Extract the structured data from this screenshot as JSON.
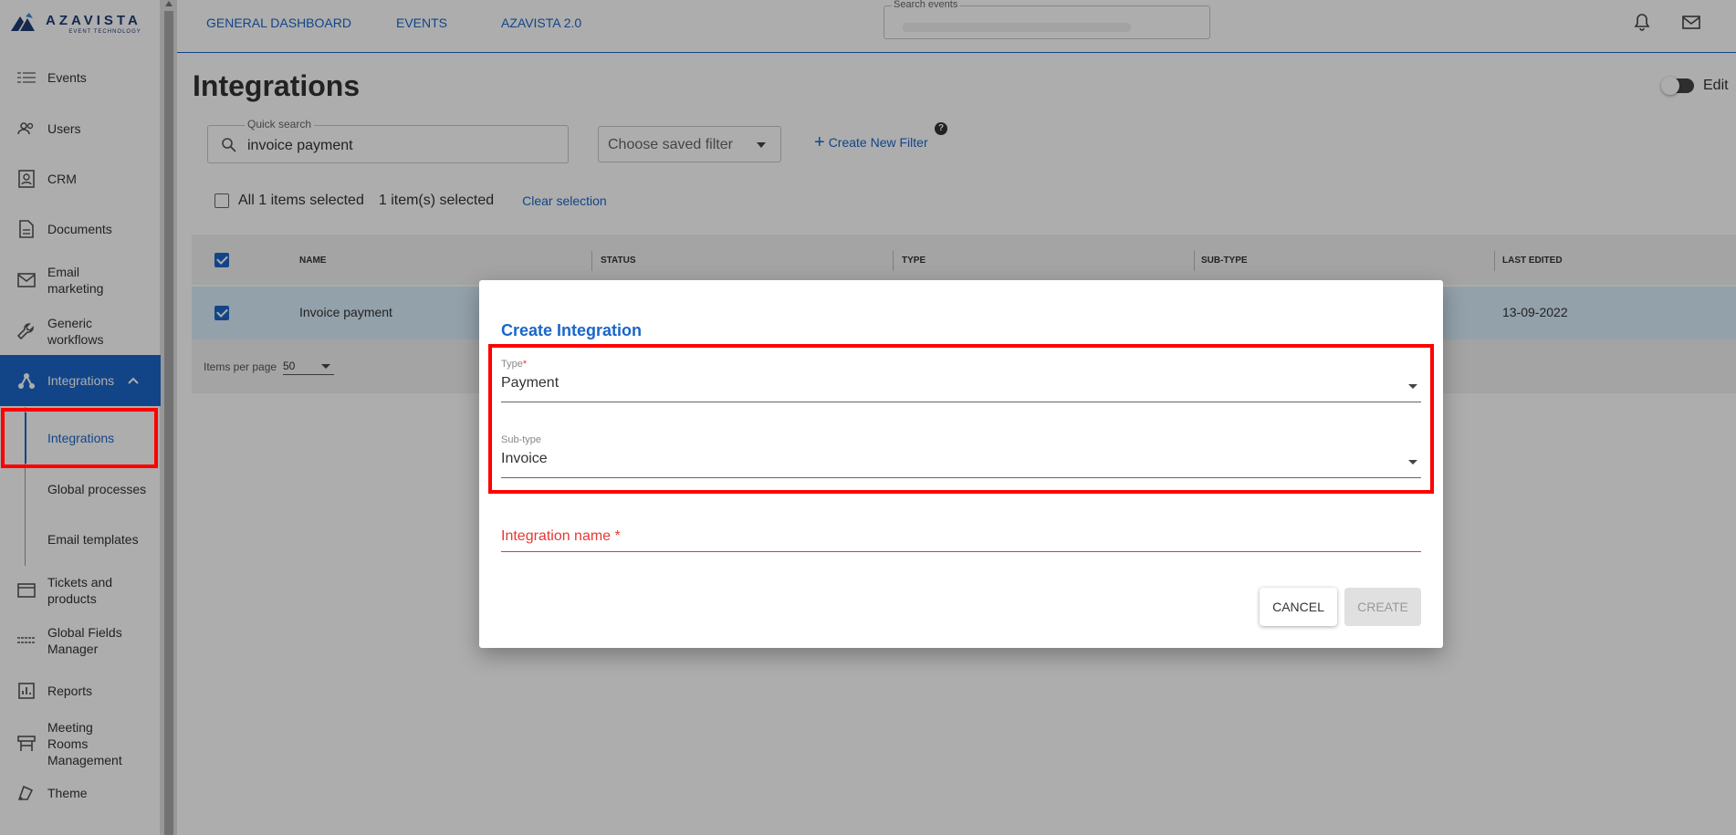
{
  "brand": {
    "name": "AZAVISTA",
    "tagline": "EVENT TECHNOLOGY",
    "color": "#1f3b73"
  },
  "sidebar": {
    "items": [
      {
        "label": "Events",
        "icon": "list-icon"
      },
      {
        "label": "Users",
        "icon": "users-icon"
      },
      {
        "label": "CRM",
        "icon": "contact-card-icon"
      },
      {
        "label": "Documents",
        "icon": "document-icon"
      },
      {
        "label": "Email\nmarketing",
        "icon": "mail-icon"
      },
      {
        "label": "Generic\nworkflows",
        "icon": "wrench-icon"
      },
      {
        "label": "Integrations",
        "icon": "integration-icon",
        "active": true
      },
      {
        "label": "Tickets and\nproducts",
        "icon": "ticket-icon"
      },
      {
        "label": "Global Fields\nManager",
        "icon": "fields-icon"
      },
      {
        "label": "Reports",
        "icon": "reports-icon"
      },
      {
        "label": "Meeting\nRooms\nManagement",
        "icon": "meeting-room-icon"
      },
      {
        "label": "Theme",
        "icon": "theme-icon"
      }
    ],
    "sub_items": [
      {
        "label": "Integrations",
        "current": true
      },
      {
        "label": "Global processes"
      },
      {
        "label": "Email templates"
      }
    ]
  },
  "topbar": {
    "links": [
      "GENERAL DASHBOARD",
      "EVENTS",
      "AZAVISTA 2.0"
    ],
    "search_label": "Search events"
  },
  "page": {
    "title": "Integrations",
    "edit_label": "Edit",
    "quick_search_label": "Quick search",
    "quick_search_value": "invoice payment",
    "saved_filter_placeholder": "Choose saved filter",
    "create_filter_label": "Create New Filter",
    "help_mark": "?",
    "selection": {
      "all_label": "All 1 items selected",
      "count_label": "1 item(s) selected",
      "clear_label": "Clear selection"
    },
    "table": {
      "columns": [
        "NAME",
        "STATUS",
        "TYPE",
        "SUB-TYPE",
        "LAST EDITED"
      ],
      "rows": [
        {
          "name": "Invoice payment",
          "status": "",
          "type": "",
          "subtype": "",
          "last_edited": "13-09-2022",
          "selected": true
        }
      ],
      "items_per_page_label": "Items per page",
      "items_per_page_value": "50"
    }
  },
  "dialog": {
    "title": "Create Integration",
    "type_label": "Type",
    "type_value": "Payment",
    "subtype_label": "Sub-type",
    "subtype_value": "Invoice",
    "name_label": "Integration name",
    "required_mark": "*",
    "cancel_label": "CANCEL",
    "create_label": "CREATE"
  },
  "colors": {
    "accent": "#1b66c9",
    "highlight": "#ff0000",
    "error": "#e53935"
  }
}
